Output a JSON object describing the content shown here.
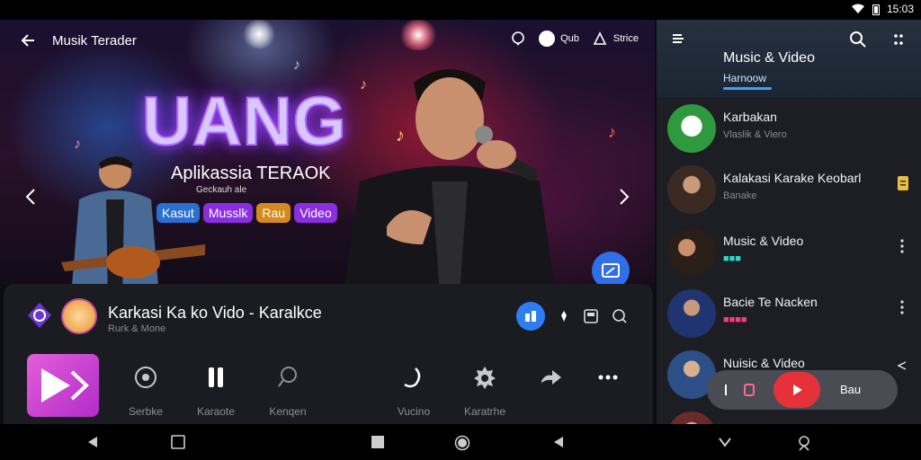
{
  "status": {
    "time": "15:03"
  },
  "app": {
    "title": "Musik Terader"
  },
  "top_actions": {
    "chip1": "Qub",
    "chip2": "Strice"
  },
  "hero": {
    "headline": "UANG",
    "subtitle": "Aplikassia TERAOK",
    "subtitle_small": "Geckauh ale",
    "tags": [
      {
        "label": "Kasut",
        "color": "#2b6fd1"
      },
      {
        "label": "Musslk",
        "color": "#8a2ee0"
      },
      {
        "label": "Rau",
        "color": "#d48a20"
      },
      {
        "label": "Video",
        "color": "#8a2ee0"
      }
    ]
  },
  "now_playing": {
    "title": "Karkasi Ka ko Vido - Karalkce",
    "subtitle": "Rurk & Mone"
  },
  "controls": [
    {
      "icon": "record-icon",
      "label": "Serbke"
    },
    {
      "icon": "pause-icon",
      "label": "Karaote"
    },
    {
      "icon": "search-music-icon",
      "label": "Kenqen"
    },
    {
      "icon": "mic-icon",
      "label": "Vucino"
    },
    {
      "icon": "gear-icon",
      "label": "Karatrhe"
    },
    {
      "icon": "share-icon",
      "label": ""
    },
    {
      "icon": "more-icon",
      "label": ""
    }
  ],
  "sidebar": {
    "title": "Music & Video",
    "tab": "Harnoow",
    "items": [
      {
        "name": "Karbakan",
        "sub": "Vlaslik & Viero",
        "accent": "#3aa04a"
      },
      {
        "name": "Kalakasi Karake Keobarl",
        "sub": "Banake",
        "accent": "#6a4b3a"
      },
      {
        "name": "Music & Video",
        "sub": "■■■",
        "accent": "#3a2a20"
      },
      {
        "name": "Bacie Te Nacken",
        "sub": "■■■■",
        "accent": "#243a6a"
      },
      {
        "name": "Nuisic & Video",
        "sub": "",
        "accent": "#2a4a7a"
      }
    ]
  },
  "mini_player": {
    "label": "Bau"
  },
  "colors": {
    "accent_blue": "#2d7ef2",
    "accent_red": "#e5313a",
    "accent_pink": "#d94bd0"
  }
}
